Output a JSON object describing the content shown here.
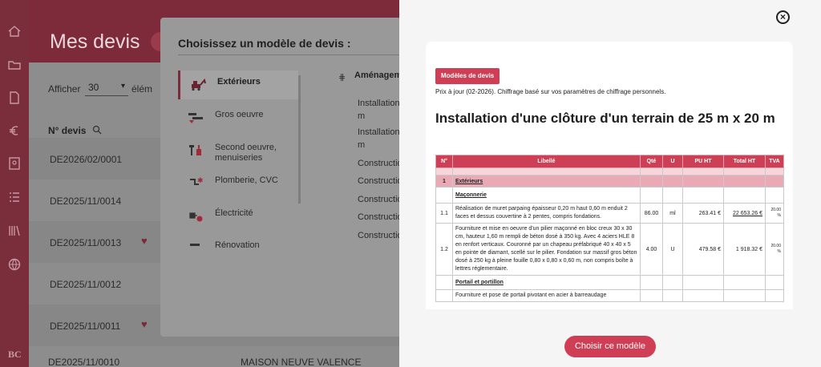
{
  "background": {
    "title": "Mes devis",
    "show_label": "Afficher",
    "per_page": "30",
    "elements_label": "élém",
    "col_header": "N° devis",
    "rows": [
      {
        "num": "DE2026/02/0001",
        "fav": false
      },
      {
        "num": "DE2025/11/0014",
        "fav": false
      },
      {
        "num": "DE2025/11/0013",
        "fav": true
      },
      {
        "num": "DE2025/11/0012",
        "fav": false
      },
      {
        "num": "DE2025/11/0011",
        "fav": true
      }
    ],
    "last_row": {
      "num": "DE2025/11/0010",
      "client": "MAISON NEUVE VALENCE"
    }
  },
  "chooser": {
    "title": "Choisissez un modèle de devis :",
    "categories": [
      {
        "label": "Extérieurs",
        "icon": "excavator-icon",
        "active": true
      },
      {
        "label": "Gros oeuvre",
        "icon": "trowel-icon",
        "active": false
      },
      {
        "label": "Second oeuvre, menuiseries",
        "icon": "tools-icon",
        "active": false
      },
      {
        "label": "Plomberie, CVC",
        "icon": "plumbing-icon",
        "active": false
      },
      {
        "label": "Électricité",
        "icon": "plug-icon",
        "active": false
      },
      {
        "label": "Rénovation",
        "icon": "renovation-icon",
        "active": false
      }
    ],
    "column_head": "Aménagem",
    "items": [
      "Installation",
      "m",
      "Installation",
      "m",
      "Construction",
      "Construction",
      "Construction",
      "Construction",
      "Construction"
    ]
  },
  "preview": {
    "tag": "Modèles de devis",
    "subtitle": "Prix à jour (02-2026). Chiffrage basé sur vos paramètres de chiffrage personnels.",
    "title": "Installation d'une clôture d'un terrain de 25 m x 20 m",
    "headers": [
      "N°",
      "Libellé",
      "Qté",
      "U",
      "PU HT",
      "Total HT",
      "TVA"
    ],
    "section": {
      "num": "1",
      "label": "Extérieurs"
    },
    "group1": "Maçonnerie",
    "lines": [
      {
        "num": "1.1",
        "desc": "Réalisation de muret parpaing épaisseur 0,20 m haut 0,60 m enduit 2 faces et dessus couvertine à 2 pentes, compris fondations.",
        "qty": "86.00",
        "unit": "ml",
        "pu": "263.41 €",
        "total": "22 653.26 €",
        "tva": "20.00 %"
      },
      {
        "num": "1.2",
        "desc": "Fourniture et mise en oeuvre d'un pilier maçonné en bloc creux 30 x 30 cm, hauteur 1,60 m rempli de béton dosé à 350 kg. Avec 4 aciers HLE 8 en renfort verticaux. Couronné par un chapeau préfabriqué 40 x 40 x 5 en pointe de diamant, scellé sur le pilier. Fondation sur massif gros béton dosé à 250 kg à pleine fouille 0,80 x 0,80 x 0,60 m, non compris boîte à lettres réglementaire.",
        "qty": "4.00",
        "unit": "U",
        "pu": "479.58 €",
        "total": "1 918.32 €",
        "tva": "20.00 %"
      }
    ],
    "group2": "Portail et portillon",
    "line3_desc": "Fourniture et pose de portail pivotant en acier à barreaudage",
    "choose_button": "Choisir ce modèle",
    "close_label": "×"
  },
  "colors": {
    "accent": "#cf3e54",
    "sidebar": "#7a2e3c",
    "overlay": "#8d8d8d"
  }
}
